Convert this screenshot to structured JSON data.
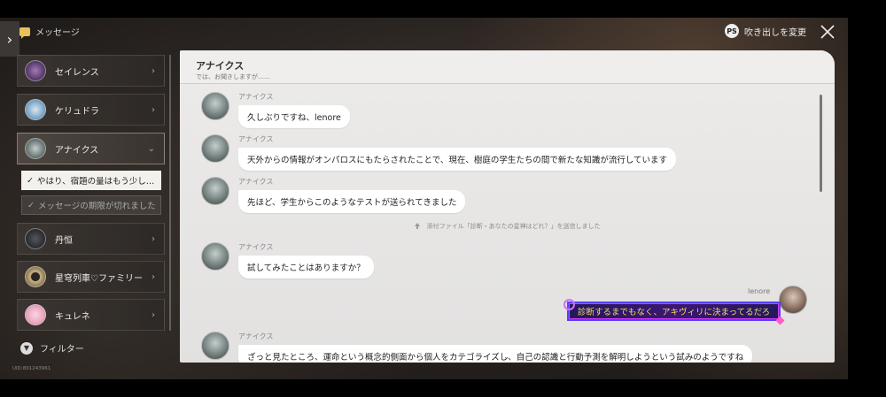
{
  "header": {
    "title": "メッセージ",
    "bubble_change": "吹き出しを変更",
    "bubble_icon_text": "PS"
  },
  "sidebar": {
    "contacts": [
      {
        "name": "セイレンス",
        "color": "#5b3f6e"
      },
      {
        "name": "ケリュドラ",
        "color": "#7fa8c9"
      },
      {
        "name": "アナイクス",
        "color": "#6d7a78"
      },
      {
        "name": "丹恒",
        "color": "#2f3035"
      },
      {
        "name": "星穹列車♡ファミリー",
        "color": "#c9b48a"
      },
      {
        "name": "キュレネ",
        "color": "#e8a6c0"
      }
    ],
    "threads": [
      {
        "label": "やはり、宿題の量はもう少し…",
        "check": "✓"
      },
      {
        "label": "メッセージの期限が切れました",
        "check": "✓"
      }
    ],
    "filter_label": "フィルター",
    "uid": "UID:801243961"
  },
  "chat": {
    "title": "アナイクス",
    "subtitle": "では、お聞きしますが……",
    "messages": [
      {
        "sender": "アナイクス",
        "text": "久しぶりですね、lenore"
      },
      {
        "sender": "アナイクス",
        "text": "天外からの情報がオンパロスにもたらされたことで、現在、樹庭の学生たちの間で新たな知識が流行しています"
      },
      {
        "sender": "アナイクス",
        "text": "先ほど、学生からこのようなテストが送られてきました"
      },
      {
        "sender": "アナイクス",
        "text": "試してみたことはありますか？"
      },
      {
        "sender": "アナイクス",
        "text": "ざっと見たところ、運命という概念的側面から個人をカテゴライズし、自己の認識と行動予測を解明しようという試みのようですね"
      }
    ],
    "system_message": "添付ファイル「診断・あなたの星神はどれ？」を送信しました",
    "my_name": "lenore",
    "my_message": "診断するまでもなく、アキヴィリに決まってるだろ"
  }
}
